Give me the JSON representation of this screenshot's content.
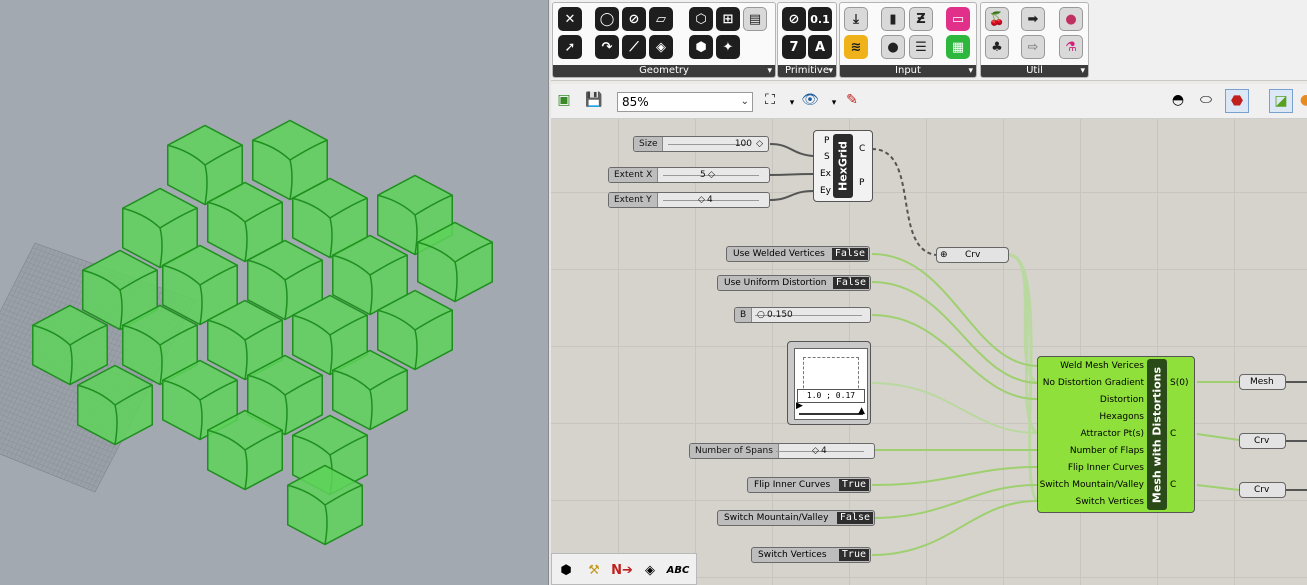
{
  "ribbon": {
    "panels": [
      {
        "title": "Geometry",
        "icons": [
          "hexagon-x-icon",
          "circle-icon",
          "ellipse-icon",
          "rectangle-icon",
          "box-icon",
          "grid-icon",
          "surface-icon",
          "arrow-icon",
          "arc-icon",
          "line-icon",
          "plane-icon",
          "brep-icon",
          "mesh-icon"
        ]
      },
      {
        "title": "Primitive",
        "icons": [
          "angle-icon",
          "number-icon",
          "integer-icon",
          "text-icon"
        ],
        "labels": [
          "0.1",
          "7",
          "A"
        ]
      },
      {
        "title": "Input",
        "icons": [
          "import-icon",
          "phone-icon",
          "boolean-icon",
          "slider-icon",
          "gradient-icon",
          "button-icon",
          "list-icon",
          "image-icon"
        ]
      },
      {
        "title": "Util",
        "icons": [
          "cherry-icon",
          "arrow-right-icon",
          "dots-icon",
          "tree-icon",
          "arrow-outline-icon",
          "flask-icon"
        ]
      }
    ]
  },
  "toolbar": {
    "zoom": "85%"
  },
  "sliders": [
    {
      "label": "Size",
      "value": "100"
    },
    {
      "label": "Extent X",
      "value": "5"
    },
    {
      "label": "Extent Y",
      "value": "4"
    },
    {
      "label": "B",
      "value": "0.150"
    },
    {
      "label": "Number of Spans",
      "value": "4"
    }
  ],
  "toggles": [
    {
      "label": "Use Welded Vertices",
      "state": "False"
    },
    {
      "label": "Use Uniform Distortion",
      "state": "False"
    },
    {
      "label": "Flip Inner Curves",
      "state": "True"
    },
    {
      "label": "Switch Mountain/Valley",
      "state": "False"
    },
    {
      "label": "Switch Vertices",
      "state": "True"
    }
  ],
  "hexgrid": {
    "name": "HexGrid",
    "inputs": [
      "P",
      "S",
      "Ex",
      "Ey"
    ],
    "outputs": [
      "C",
      "P"
    ]
  },
  "crv_param": "Crv",
  "graph_mapper": {
    "readout": "1.0 ; 0.17"
  },
  "mesh_component": {
    "name": "Mesh with Distortions",
    "inputs": [
      "Weld Mesh Verices",
      "No Distortion Gradient",
      "Distortion",
      "Hexagons",
      "Attractor Pt(s)",
      "Number of Flaps",
      "Flip Inner Curves",
      "Switch Mountain/Valley",
      "Switch Vertices"
    ],
    "outputs": [
      "S(0)",
      "C",
      "C"
    ]
  },
  "outputs": [
    "Mesh",
    "Crv",
    "Crv"
  ],
  "colors": {
    "component_green": "#8fe03a",
    "mesh_green": "#5ed25a",
    "viewport_bg": "#a3a9b0"
  },
  "bottom_icons": [
    "galaxy-icon",
    "tools-icon",
    "switch-icon",
    "group-icon",
    "abc-icon"
  ]
}
